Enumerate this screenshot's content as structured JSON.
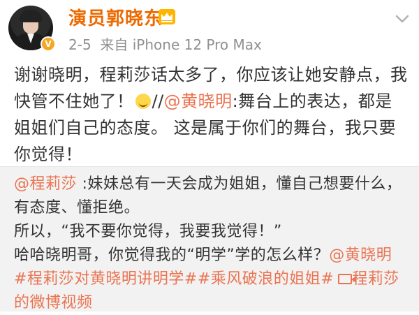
{
  "post": {
    "username": "演员郭晓东",
    "crown_icon": "crown-icon",
    "verified_icon": "verified-v-icon",
    "date": "2-5",
    "source": "来自 iPhone 12 Pro Max",
    "body": {
      "part1": "谢谢晓明，程莉莎话太多了，你应该让她安静点，我快管不住她了！",
      "emoji": "laugh-emoji",
      "part2": "//",
      "mention": "@黄晓明",
      "part3": ":舞台上的表达，都是姐姐们自己的态度。 这是属于你们的舞台，我只要你觉得！"
    }
  },
  "quoted": {
    "mention": "@程莉莎",
    "line1": " :妹妹总有一天会成为姐姐，懂自己想要什么，有态度、懂拒绝。",
    "line2": "所以，“我不要你觉得，我要我觉得！”",
    "line3": "哈哈晓明哥，你觉得我的“明学”学的怎么样？",
    "mention2": "@黄晓明",
    "tag1": "#程莉莎对黄晓明讲明学#",
    "tag2": "#乘风破浪的姐姐#",
    "video_link": "程莉莎的微博视频"
  },
  "colors": {
    "username": "#ec6a00",
    "link": "#eb7350",
    "meta": "#909090",
    "quote_bg": "#f2f2f2"
  }
}
